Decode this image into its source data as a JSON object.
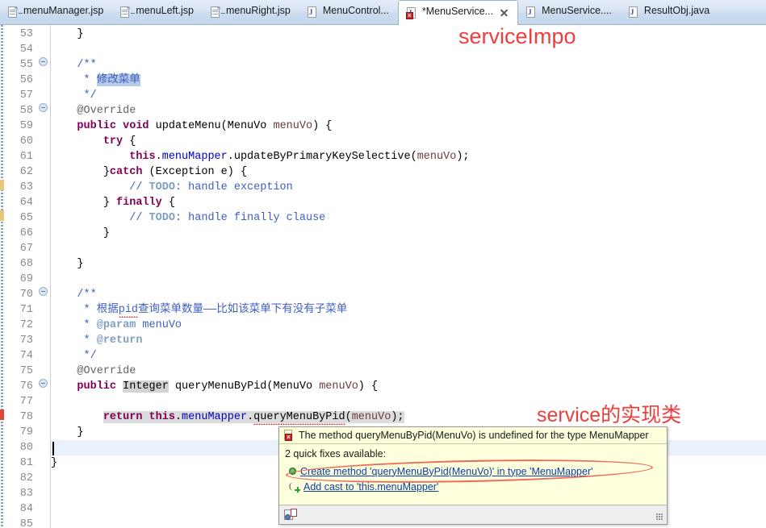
{
  "window": {
    "application": "Eclipse IDE Java Editor"
  },
  "tabs": [
    {
      "label": "menuManager.jsp",
      "icon": "jsp-file-icon",
      "active": false,
      "dirty": false,
      "closable": false
    },
    {
      "label": "menuLeft.jsp",
      "icon": "jsp-file-icon",
      "active": false,
      "dirty": false,
      "closable": false
    },
    {
      "label": "menuRight.jsp",
      "icon": "jsp-file-icon",
      "active": false,
      "dirty": false,
      "closable": false
    },
    {
      "label": "MenuControl...",
      "icon": "java-file-icon",
      "active": false,
      "dirty": false,
      "closable": false
    },
    {
      "label": "*MenuService...",
      "icon": "java-file-error-icon",
      "active": true,
      "dirty": true,
      "closable": true
    },
    {
      "label": "MenuService....",
      "icon": "java-file-icon",
      "active": false,
      "dirty": false,
      "closable": false
    },
    {
      "label": "ResultObj.java",
      "icon": "java-file-icon",
      "active": false,
      "dirty": false,
      "closable": false
    }
  ],
  "annotations": [
    {
      "id": "annot-top",
      "text": "serviceImpo",
      "color": "#ee3d3d"
    },
    {
      "id": "annot-bottom",
      "text": "service的实现类",
      "color": "#ee3d3d"
    }
  ],
  "editor": {
    "first_line": 53,
    "last_line": 85,
    "current_line": 80,
    "line_numbers": [
      53,
      54,
      55,
      56,
      57,
      58,
      59,
      60,
      61,
      62,
      63,
      64,
      65,
      66,
      67,
      68,
      69,
      70,
      71,
      72,
      73,
      74,
      75,
      76,
      77,
      78,
      79,
      80,
      81,
      82,
      83,
      84,
      85
    ],
    "fold_markers": [
      55,
      58,
      70,
      75
    ],
    "warning_markers": [
      63,
      65
    ],
    "error_markers": [
      78
    ],
    "lines": {
      "53": "    }",
      "54": "",
      "55": "    /**",
      "56": "     *  修改菜单",
      "57": "     */",
      "58": "    @Override",
      "59": "    public void updateMenu(MenuVo menuVo) {",
      "60": "        try {",
      "61": "            this.menuMapper.updateByPrimaryKeySelective(menuVo);",
      "62": "        }catch (Exception e) {",
      "63": "            // TODO: handle exception",
      "64": "        } finally {",
      "65": "            // TODO: handle finally clause",
      "66": "        }",
      "67": "",
      "68": "    }",
      "69": "",
      "70": "    /**",
      "71": "     *  根据pid查询菜单数量——比如该菜单下有没有子菜单",
      "72": "     *  @param menuVo",
      "73": "     *  @return",
      "74": "     */",
      "75": "    @Override",
      "76": "    public Integer queryMenuByPid(MenuVo menuVo) {",
      "77": "",
      "78": "        return this.menuMapper.queryMenuByPid(menuVo);",
      "79": "    }",
      "80": "",
      "81": "}",
      "82": "",
      "83": "",
      "84": "",
      "85": ""
    },
    "tokens": {
      "kw_public": "public",
      "kw_void": "void",
      "kw_try": "try",
      "kw_catch": "catch",
      "kw_finally": "finally",
      "kw_this": "this",
      "kw_return": "return",
      "ann_override": "@Override",
      "selected_text": "修改菜单",
      "occurrence_highlight": "Integer",
      "misspelled_word": "pid",
      "error_underline": "this.menuMapper.queryMenuByPid(menuVo);"
    }
  },
  "popup": {
    "title": "The method queryMenuByPid(MenuVo) is undefined for the type MenuMapper",
    "subtitle": "2 quick fixes available:",
    "fixes": [
      {
        "label": "Create method 'queryMenuByPid(MenuVo)' in type 'MenuMapper'",
        "icon": "green-dot-icon",
        "circled": true
      },
      {
        "label": "Add cast to 'this.menuMapper'",
        "icon": "cast-add-icon",
        "circled": false
      }
    ],
    "footer_icon": "configure-problem-severity-icon"
  },
  "colors": {
    "keyword": "#7f0055",
    "comment": "#3f5fbf",
    "javadoc_tag": "#7f9fbf",
    "field": "#0000c0",
    "annotation_red": "#ee3d3d",
    "popup_bg": "#feffdd",
    "current_line_bg": "#e8f1fc",
    "selection_bg": "#b6c9e8",
    "occurrence_bg": "#d4d4d4",
    "tab_active_bg": "#ffffff"
  }
}
